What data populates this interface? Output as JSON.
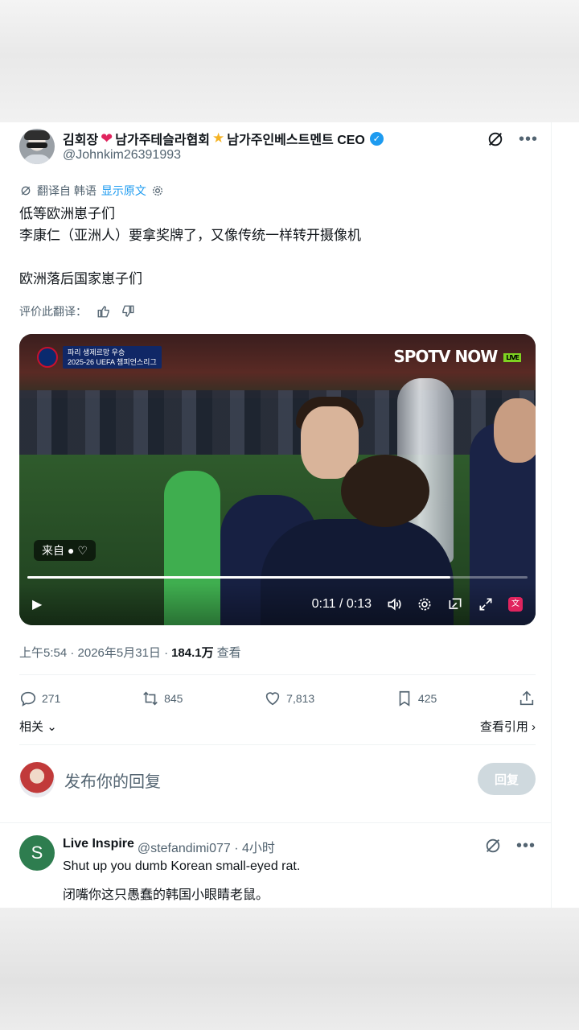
{
  "author": {
    "name_part1": "김회장",
    "name_part2": "남가주테슬라협회",
    "name_part3": "남가주인베스트멘트 CEO",
    "handle": "@Johnkim26391993"
  },
  "translation": {
    "label": "翻译自 韩语",
    "show_original": "显示原文"
  },
  "tweet": {
    "lines": [
      "低等欧洲崽子们",
      "李康仁（亚洲人）要拿奖牌了，又像传统一样转开摄像机",
      "",
      "欧洲落后国家崽子们"
    ]
  },
  "rate": {
    "label": "评价此翻译："
  },
  "video": {
    "broadcaster": "SPOTV NOW",
    "live_tag": "LIVE",
    "scoreboard_title": "파리 생제르망 우승",
    "scoreboard_sub": "2025-26 UEFA 챔피언스리그",
    "from_badge": "来自",
    "time": "0:11 / 0:13",
    "progress": 0.846
  },
  "meta": {
    "time": "上午5:54 · 2026年5月31日 · ",
    "views": "184.1万",
    "views_label": " 查看"
  },
  "actions": {
    "replies": "271",
    "reposts": "845",
    "likes": "7,813",
    "bookmarks": "425"
  },
  "related": {
    "label": "相关",
    "quotes": "查看引用"
  },
  "reply_box": {
    "placeholder": "发布你的回复",
    "button": "回复"
  },
  "comment": {
    "avatar_letter": "S",
    "name": "Live Inspire",
    "handle": "@stefandimi077 · 4小时",
    "text": "Shut up you dumb Korean small-eyed rat.",
    "translation": "闭嘴你这只愚蠢的韩国小眼睛老鼠。"
  },
  "colors": {
    "accent": "#1d9bf0",
    "muted": "#536471",
    "heart": "#e0245e"
  }
}
